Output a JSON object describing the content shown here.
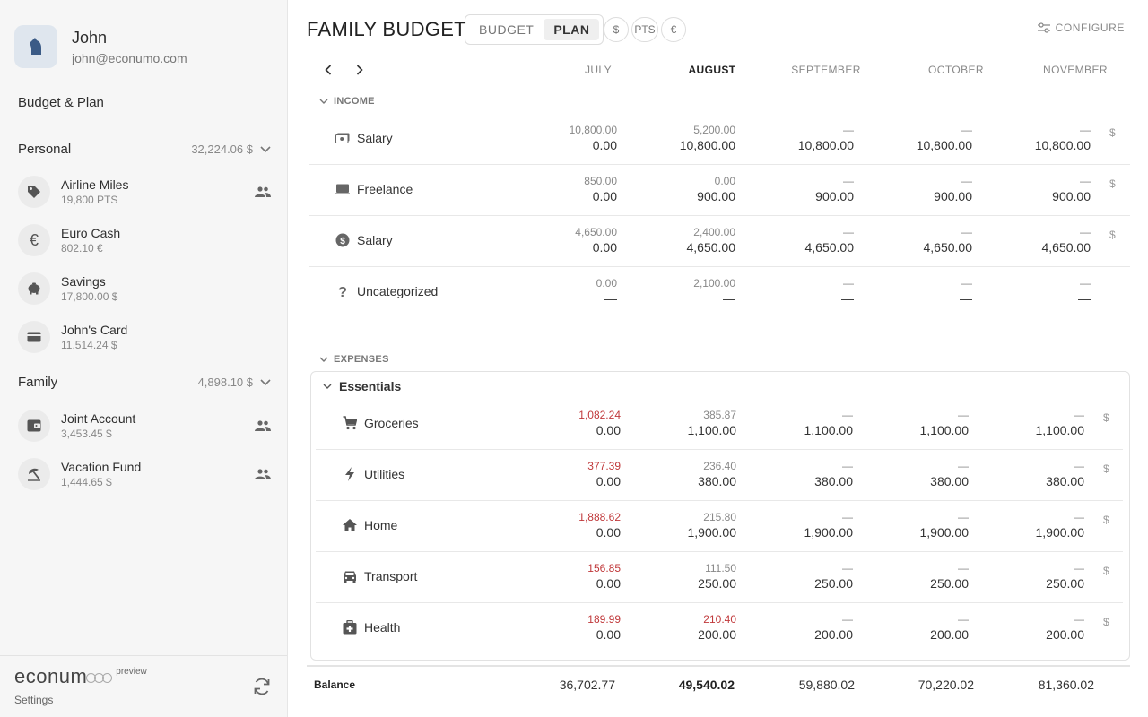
{
  "user": {
    "name": "John",
    "email": "john@econumo.com"
  },
  "sidebar": {
    "menu_link": "Budget & Plan",
    "folders": [
      {
        "name": "Personal",
        "total": "32,224.06 $",
        "accounts": [
          {
            "name": "Airline Miles",
            "balance": "19,800 PTS",
            "icon": "tag-icon",
            "shared": true
          },
          {
            "name": "Euro Cash",
            "balance": "802.10 €",
            "icon": "euro-icon",
            "shared": false
          },
          {
            "name": "Savings",
            "balance": "17,800.00 $",
            "icon": "piggy-bank-icon",
            "shared": false
          },
          {
            "name": "John's Card",
            "balance": "11,514.24 $",
            "icon": "credit-card-icon",
            "shared": false
          }
        ]
      },
      {
        "name": "Family",
        "total": "4,898.10 $",
        "accounts": [
          {
            "name": "Joint Account",
            "balance": "3,453.45 $",
            "icon": "wallet-icon",
            "shared": true
          },
          {
            "name": "Vacation Fund",
            "balance": "1,444.65 $",
            "icon": "beach-umbrella-icon",
            "shared": true
          }
        ]
      }
    ],
    "footer": {
      "logo": "econum",
      "badge": "preview",
      "settings": "Settings"
    }
  },
  "header": {
    "title": "FAMILY BUDGET",
    "tabs": [
      {
        "label": "BUDGET",
        "active": false
      },
      {
        "label": "PLAN",
        "active": true
      }
    ],
    "currencies": [
      "$",
      "PTS",
      "€"
    ],
    "configure": "CONFIGURE"
  },
  "months": [
    "JULY",
    "AUGUST",
    "SEPTEMBER",
    "OCTOBER",
    "NOVEMBER"
  ],
  "current_month_index": 1,
  "income": {
    "label": "INCOME",
    "rows": [
      {
        "name": "Salary",
        "icon": "cash-icon",
        "currency": "$",
        "cells": [
          [
            "10,800.00",
            "0.00"
          ],
          [
            "5,200.00",
            "10,800.00"
          ],
          [
            "—",
            "10,800.00"
          ],
          [
            "—",
            "10,800.00"
          ],
          [
            "—",
            "10,800.00"
          ]
        ]
      },
      {
        "name": "Freelance",
        "icon": "laptop-icon",
        "currency": "$",
        "cells": [
          [
            "850.00",
            "0.00"
          ],
          [
            "0.00",
            "900.00"
          ],
          [
            "—",
            "900.00"
          ],
          [
            "—",
            "900.00"
          ],
          [
            "—",
            "900.00"
          ]
        ]
      },
      {
        "name": "Salary",
        "icon": "dollar-circle-icon",
        "currency": "$",
        "cells": [
          [
            "4,650.00",
            "0.00"
          ],
          [
            "2,400.00",
            "4,650.00"
          ],
          [
            "—",
            "4,650.00"
          ],
          [
            "—",
            "4,650.00"
          ],
          [
            "—",
            "4,650.00"
          ]
        ]
      },
      {
        "name": "Uncategorized",
        "icon": "question-icon",
        "currency": "",
        "cells": [
          [
            "0.00",
            "—"
          ],
          [
            "2,100.00",
            "—"
          ],
          [
            "—",
            "—"
          ],
          [
            "—",
            "—"
          ],
          [
            "—",
            "—"
          ]
        ]
      }
    ]
  },
  "expenses": {
    "label": "EXPENSES",
    "group": "Essentials",
    "rows": [
      {
        "name": "Groceries",
        "icon": "cart-icon",
        "currency": "$",
        "cells": [
          [
            "1,082.24",
            "0.00",
            true
          ],
          [
            "385.87",
            "1,100.00",
            false
          ],
          [
            "—",
            "1,100.00",
            false
          ],
          [
            "—",
            "1,100.00",
            false
          ],
          [
            "—",
            "1,100.00",
            false
          ]
        ]
      },
      {
        "name": "Utilities",
        "icon": "bolt-icon",
        "currency": "$",
        "cells": [
          [
            "377.39",
            "0.00",
            true
          ],
          [
            "236.40",
            "380.00",
            false
          ],
          [
            "—",
            "380.00",
            false
          ],
          [
            "—",
            "380.00",
            false
          ],
          [
            "—",
            "380.00",
            false
          ]
        ]
      },
      {
        "name": "Home",
        "icon": "home-icon",
        "currency": "$",
        "cells": [
          [
            "1,888.62",
            "0.00",
            true
          ],
          [
            "215.80",
            "1,900.00",
            false
          ],
          [
            "—",
            "1,900.00",
            false
          ],
          [
            "—",
            "1,900.00",
            false
          ],
          [
            "—",
            "1,900.00",
            false
          ]
        ]
      },
      {
        "name": "Transport",
        "icon": "car-icon",
        "currency": "$",
        "cells": [
          [
            "156.85",
            "0.00",
            true
          ],
          [
            "111.50",
            "250.00",
            false
          ],
          [
            "—",
            "250.00",
            false
          ],
          [
            "—",
            "250.00",
            false
          ],
          [
            "—",
            "250.00",
            false
          ]
        ]
      },
      {
        "name": "Health",
        "icon": "medical-kit-icon",
        "currency": "$",
        "cells": [
          [
            "189.99",
            "0.00",
            true
          ],
          [
            "210.40",
            "200.00",
            true
          ],
          [
            "—",
            "200.00",
            false
          ],
          [
            "—",
            "200.00",
            false
          ],
          [
            "—",
            "200.00",
            false
          ]
        ]
      }
    ]
  },
  "balance": {
    "label": "Balance",
    "values": [
      "36,702.77",
      "49,540.02",
      "59,880.02",
      "70,220.02",
      "81,360.02"
    ]
  },
  "colors": {
    "accent_red": "#c0393b",
    "sidebar_bg": "#f6f6f6",
    "avatar_bg": "#dfe6ee",
    "avatar_icon": "#3b5b86"
  }
}
